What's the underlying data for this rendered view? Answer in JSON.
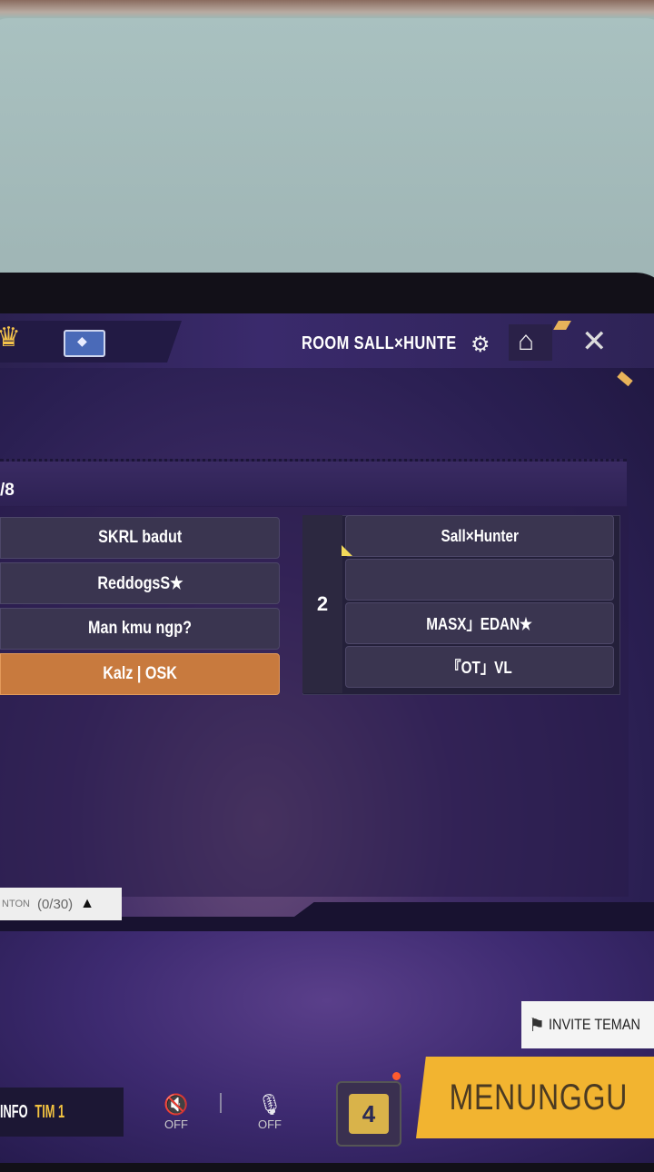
{
  "header": {
    "room_title": "ROOM SALL×HUNTE"
  },
  "team1": {
    "slot_count": "/8",
    "players": [
      "SKRL badut",
      "ReddogsS★",
      "Man kmu ngp?",
      "Kalz | OSK"
    ]
  },
  "team2": {
    "number": "2",
    "players": [
      "Sall×Hunter",
      "",
      "MASX」EDAN★",
      "『OT」VL"
    ]
  },
  "spectator": {
    "label": "NTON",
    "count": "(0/30)"
  },
  "invite": {
    "label": "INVITE TEMAN"
  },
  "bottom": {
    "info_label": "INFO ",
    "info_team": "TIM 1",
    "speaker_state": "OFF",
    "mic_state": "OFF",
    "dice_value": "4",
    "wait_label": "MENUNGGU"
  },
  "icons": [
    "crown-icon",
    "card-icon",
    "gear-icon",
    "home-icon",
    "close-icon",
    "speaker-mute-icon",
    "mic-mute-icon",
    "dice-icon",
    "invite-icon"
  ],
  "colors": {
    "selected_row": "#c87a3e",
    "wait_button": "#f2b430",
    "team_highlight": "#f2c240"
  }
}
